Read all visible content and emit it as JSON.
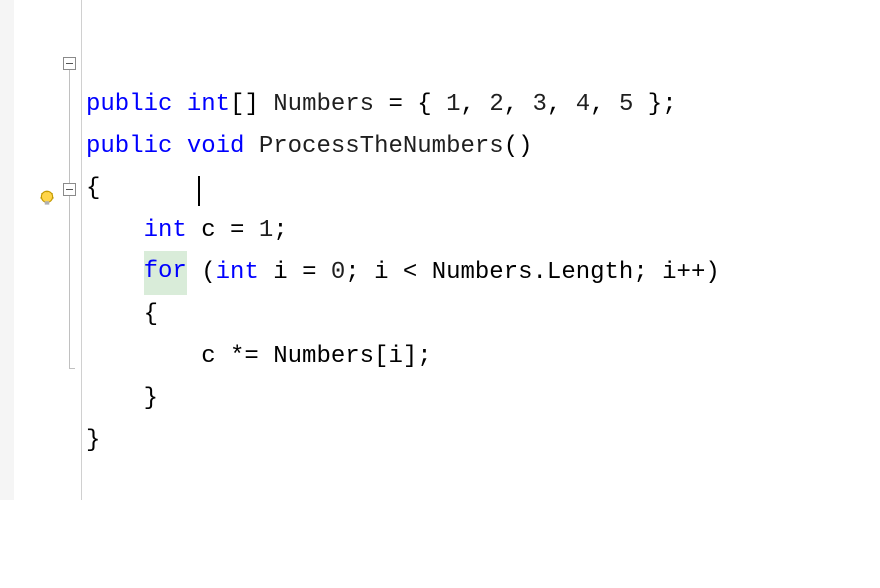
{
  "language": "C#",
  "colors": {
    "keyword": "#0000ff"
  },
  "gutter": {
    "fold_boxes": [
      {
        "line": 1,
        "state": "collapsed-expandable"
      },
      {
        "line": 5,
        "state": "collapsed-expandable"
      }
    ],
    "lightbulb_line": 5
  },
  "cursor": {
    "line": 5,
    "col_after": "fo"
  },
  "code": {
    "lines": [
      {
        "indent": 0,
        "tokens": [
          {
            "t": "public",
            "c": "kw"
          },
          {
            "t": " "
          },
          {
            "t": "int",
            "c": "kw"
          },
          {
            "t": "[] "
          },
          {
            "t": "Numbers",
            "c": "ident"
          },
          {
            "t": " = { "
          },
          {
            "t": "1",
            "c": "num"
          },
          {
            "t": ", "
          },
          {
            "t": "2",
            "c": "num"
          },
          {
            "t": ", "
          },
          {
            "t": "3",
            "c": "num"
          },
          {
            "t": ", "
          },
          {
            "t": "4",
            "c": "num"
          },
          {
            "t": ", "
          },
          {
            "t": "5",
            "c": "num"
          },
          {
            "t": " };"
          }
        ]
      },
      {
        "indent": 0,
        "tokens": [
          {
            "t": "public",
            "c": "kw"
          },
          {
            "t": " "
          },
          {
            "t": "void",
            "c": "kw"
          },
          {
            "t": " "
          },
          {
            "t": "ProcessTheNumbers",
            "c": "method"
          },
          {
            "t": "()"
          }
        ]
      },
      {
        "indent": 0,
        "tokens": [
          {
            "t": "{"
          }
        ]
      },
      {
        "indent": 1,
        "tokens": [
          {
            "t": "int",
            "c": "kw"
          },
          {
            "t": " c = "
          },
          {
            "t": "1",
            "c": "num"
          },
          {
            "t": ";"
          }
        ]
      },
      {
        "indent": 1,
        "tokens": [
          {
            "t": "for",
            "c": "kw",
            "squiggle": true,
            "highlight": true
          },
          {
            "t": " ("
          },
          {
            "t": "int",
            "c": "kw"
          },
          {
            "t": " i = "
          },
          {
            "t": "0",
            "c": "num"
          },
          {
            "t": "; i < Numbers.Length; i++)"
          }
        ]
      },
      {
        "indent": 1,
        "tokens": [
          {
            "t": "{"
          }
        ]
      },
      {
        "indent": 2,
        "tokens": [
          {
            "t": "c *= Numbers[i];"
          }
        ]
      },
      {
        "indent": 1,
        "tokens": [
          {
            "t": "}"
          }
        ]
      },
      {
        "indent": 0,
        "tokens": [
          {
            "t": "}"
          }
        ]
      }
    ]
  }
}
